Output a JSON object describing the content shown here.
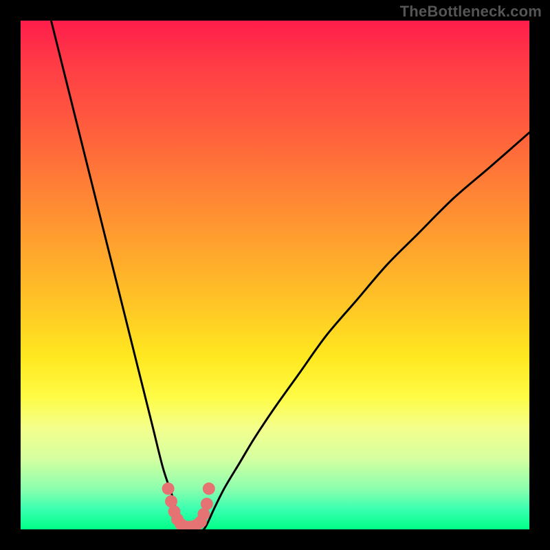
{
  "watermark": "TheBottleneck.com",
  "chart_data": {
    "type": "line",
    "title": "",
    "xlabel": "",
    "ylabel": "",
    "xlim": [
      0,
      100
    ],
    "ylim": [
      0,
      100
    ],
    "grid": false,
    "legend": false,
    "series": [
      {
        "name": "left-branch",
        "x": [
          6,
          8,
          10,
          12,
          14,
          16,
          18,
          20,
          22,
          24,
          26,
          28,
          30,
          31,
          32
        ],
        "y": [
          100,
          92,
          84,
          76,
          68,
          60,
          52,
          44,
          36,
          28,
          20,
          12,
          6,
          2,
          0
        ]
      },
      {
        "name": "right-branch",
        "x": [
          36,
          38,
          40,
          43,
          46,
          50,
          55,
          60,
          66,
          72,
          78,
          85,
          92,
          100
        ],
        "y": [
          0,
          4,
          8,
          13,
          18,
          24,
          31,
          38,
          45,
          52,
          58,
          65,
          71,
          78
        ]
      },
      {
        "name": "optimal-markers",
        "x": [
          29.0,
          29.6,
          30.2,
          30.8,
          31.5,
          32.5,
          33.5,
          34.5,
          35.4,
          36.0,
          36.6,
          37.0
        ],
        "y": [
          8.0,
          5.5,
          3.5,
          2.0,
          1.0,
          0.5,
          0.5,
          0.8,
          1.5,
          3.0,
          5.0,
          8.0
        ]
      }
    ],
    "colors": {
      "curve": "#000000",
      "markers": "#e57373",
      "gradient_top": "#ff1d4b",
      "gradient_bottom": "#00ff88"
    }
  }
}
